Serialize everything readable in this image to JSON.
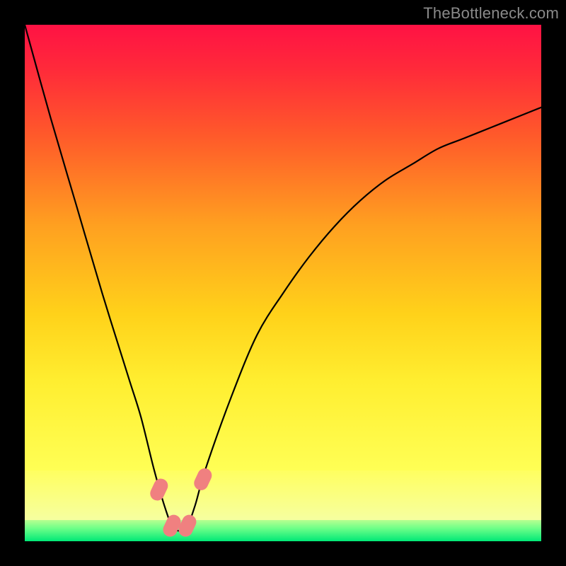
{
  "watermark": "TheBottleneck.com",
  "chart_data": {
    "type": "line",
    "title": "",
    "xlabel": "",
    "ylabel": "",
    "xlim": [
      0,
      100
    ],
    "ylim": [
      0,
      100
    ],
    "series": [
      {
        "name": "bottleneck-curve",
        "x": [
          0,
          5,
          10,
          15,
          20,
          22.5,
          25,
          27,
          28.5,
          30,
          31.5,
          33,
          35,
          40,
          45,
          50,
          55,
          60,
          65,
          70,
          75,
          80,
          85,
          90,
          95,
          100
        ],
        "values": [
          100,
          82,
          65,
          48,
          32,
          24,
          14,
          7,
          3,
          2,
          3,
          7,
          14,
          28,
          40,
          48,
          55,
          61,
          66,
          70,
          73,
          76,
          78,
          80,
          82,
          84
        ]
      }
    ],
    "annotations": [
      {
        "name": "marker-left",
        "x": 26.0,
        "y": 10
      },
      {
        "name": "marker-mid1",
        "x": 28.5,
        "y": 3
      },
      {
        "name": "marker-mid2",
        "x": 31.5,
        "y": 3
      },
      {
        "name": "marker-right",
        "x": 34.5,
        "y": 12
      }
    ],
    "green_band": {
      "y_from": 0,
      "y_to": 3
    },
    "yellow_band": {
      "y_from": 3,
      "y_to": 14
    }
  }
}
